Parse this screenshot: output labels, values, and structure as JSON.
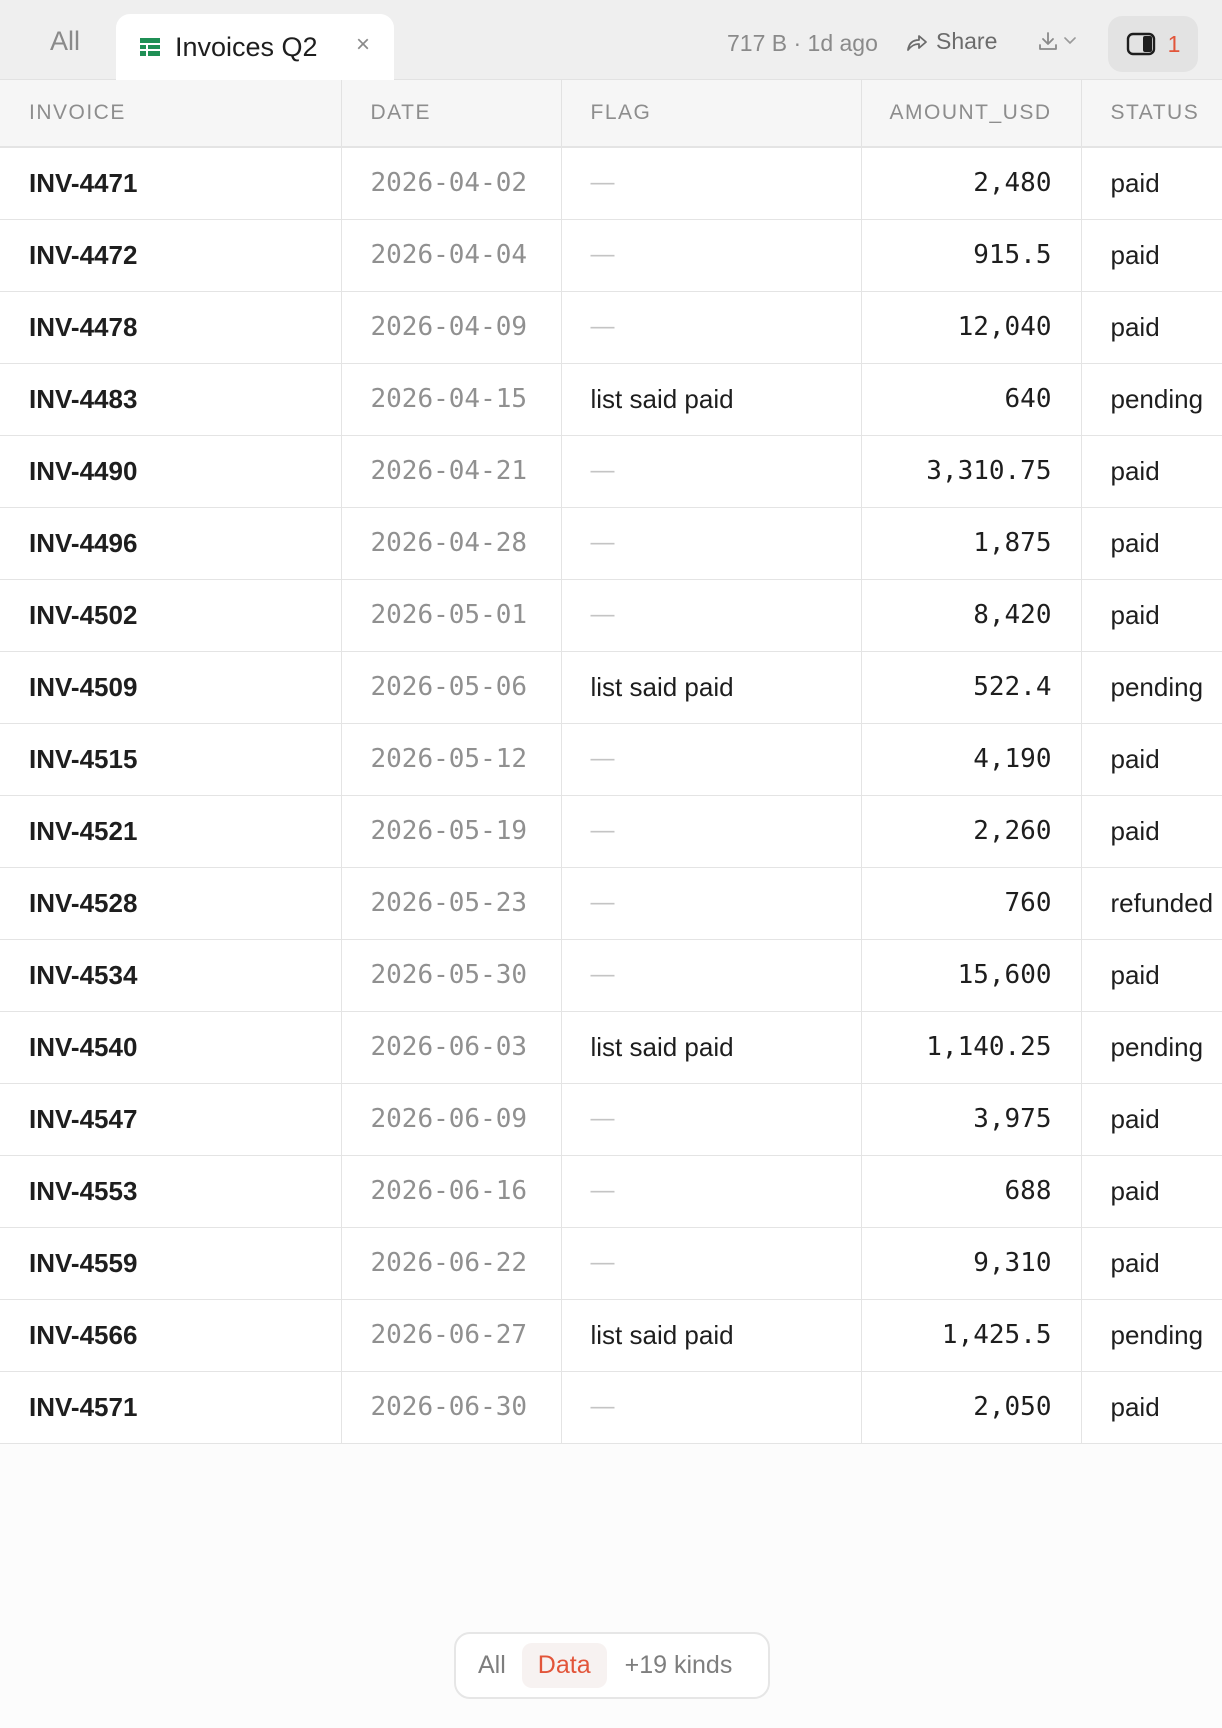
{
  "tabs": {
    "all_label": "All",
    "active_title": "Invoices Q2",
    "close_glyph": "×"
  },
  "toolbar": {
    "meta": "717 B · 1d ago",
    "share_label": "Share",
    "panel_count": "1",
    "accent_color": "#e2553a",
    "sheet_icon_color": "#1f8f55"
  },
  "table": {
    "columns": [
      "INVOICE",
      "DATE",
      "FLAG",
      "AMOUNT_USD",
      "STATUS"
    ],
    "rows": [
      {
        "invoice": "INV-4471",
        "date": "2026-04-02",
        "flag": "—",
        "amount": "2,480",
        "status": "paid"
      },
      {
        "invoice": "INV-4472",
        "date": "2026-04-04",
        "flag": "—",
        "amount": "915.5",
        "status": "paid"
      },
      {
        "invoice": "INV-4478",
        "date": "2026-04-09",
        "flag": "—",
        "amount": "12,040",
        "status": "paid"
      },
      {
        "invoice": "INV-4483",
        "date": "2026-04-15",
        "flag": "list said paid",
        "amount": "640",
        "status": "pending"
      },
      {
        "invoice": "INV-4490",
        "date": "2026-04-21",
        "flag": "—",
        "amount": "3,310.75",
        "status": "paid"
      },
      {
        "invoice": "INV-4496",
        "date": "2026-04-28",
        "flag": "—",
        "amount": "1,875",
        "status": "paid"
      },
      {
        "invoice": "INV-4502",
        "date": "2026-05-01",
        "flag": "—",
        "amount": "8,420",
        "status": "paid"
      },
      {
        "invoice": "INV-4509",
        "date": "2026-05-06",
        "flag": "list said paid",
        "amount": "522.4",
        "status": "pending"
      },
      {
        "invoice": "INV-4515",
        "date": "2026-05-12",
        "flag": "—",
        "amount": "4,190",
        "status": "paid"
      },
      {
        "invoice": "INV-4521",
        "date": "2026-05-19",
        "flag": "—",
        "amount": "2,260",
        "status": "paid"
      },
      {
        "invoice": "INV-4528",
        "date": "2026-05-23",
        "flag": "—",
        "amount": "760",
        "status": "refunded"
      },
      {
        "invoice": "INV-4534",
        "date": "2026-05-30",
        "flag": "—",
        "amount": "15,600",
        "status": "paid"
      },
      {
        "invoice": "INV-4540",
        "date": "2026-06-03",
        "flag": "list said paid",
        "amount": "1,140.25",
        "status": "pending"
      },
      {
        "invoice": "INV-4547",
        "date": "2026-06-09",
        "flag": "—",
        "amount": "3,975",
        "status": "paid"
      },
      {
        "invoice": "INV-4553",
        "date": "2026-06-16",
        "flag": "—",
        "amount": "688",
        "status": "paid"
      },
      {
        "invoice": "INV-4559",
        "date": "2026-06-22",
        "flag": "—",
        "amount": "9,310",
        "status": "paid"
      },
      {
        "invoice": "INV-4566",
        "date": "2026-06-27",
        "flag": "list said paid",
        "amount": "1,425.5",
        "status": "pending"
      },
      {
        "invoice": "INV-4571",
        "date": "2026-06-30",
        "flag": "—",
        "amount": "2,050",
        "status": "paid"
      }
    ]
  },
  "filter": {
    "all_label": "All",
    "data_label": "Data",
    "kinds_label": "+19 kinds"
  }
}
